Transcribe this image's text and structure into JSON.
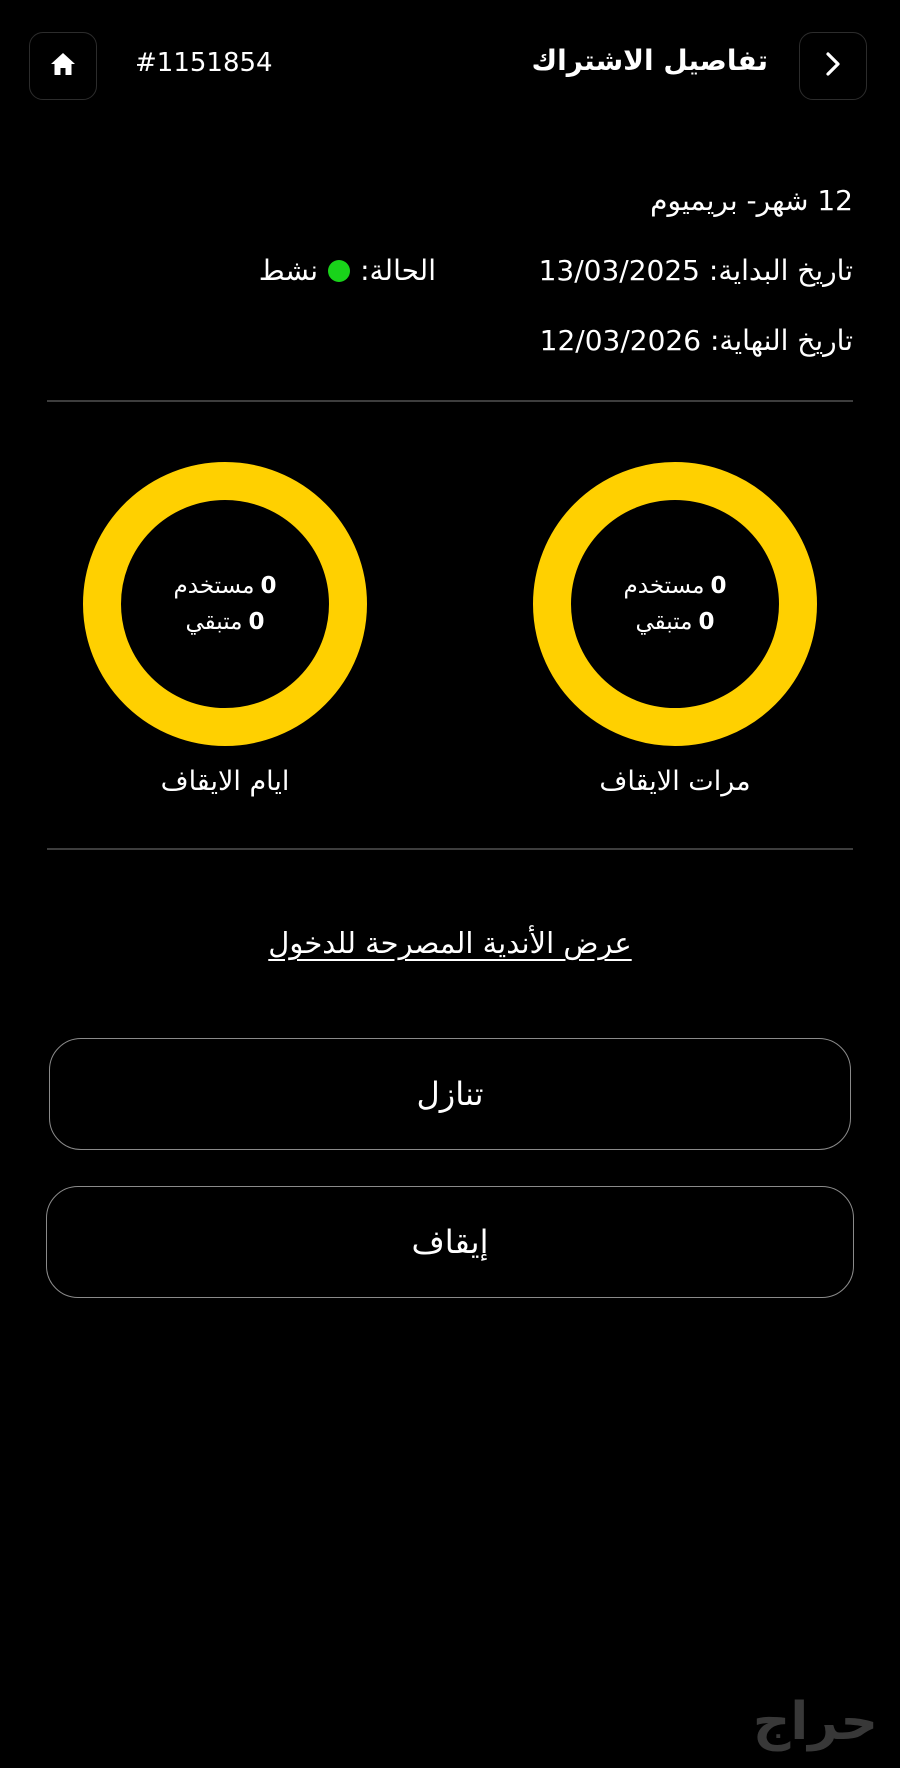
{
  "header": {
    "title": "تفاصيل الاشتراك",
    "subscription_id": "#1151854",
    "home_icon": "home-icon",
    "back_icon": "chevron-right-icon"
  },
  "subscription": {
    "plan": "12 شهر- بريميوم",
    "start_label": "تاريخ البداية:",
    "start_date": "13/03/2025",
    "status_label": "الحالة:",
    "status_value": "نشط",
    "status_color": "#19d31a",
    "end_label": "تاريخ النهاية:",
    "end_date": "12/03/2026"
  },
  "freeze_stats": {
    "accent_color": "#ffd000",
    "rings": [
      {
        "caption": "مرات الايقاف",
        "used_value": "0",
        "used_label": "مستخدم",
        "remaining_value": "0",
        "remaining_label": "متبقي"
      },
      {
        "caption": "ايام الايقاف",
        "used_value": "0",
        "used_label": "مستخدم",
        "remaining_value": "0",
        "remaining_label": "متبقي"
      }
    ]
  },
  "actions": {
    "clubs_link": "عرض الأندية المصرحة للدخول",
    "transfer_button": "تنازل",
    "freeze_button": "إيقاف"
  },
  "watermark": {
    "text": "حراج"
  }
}
